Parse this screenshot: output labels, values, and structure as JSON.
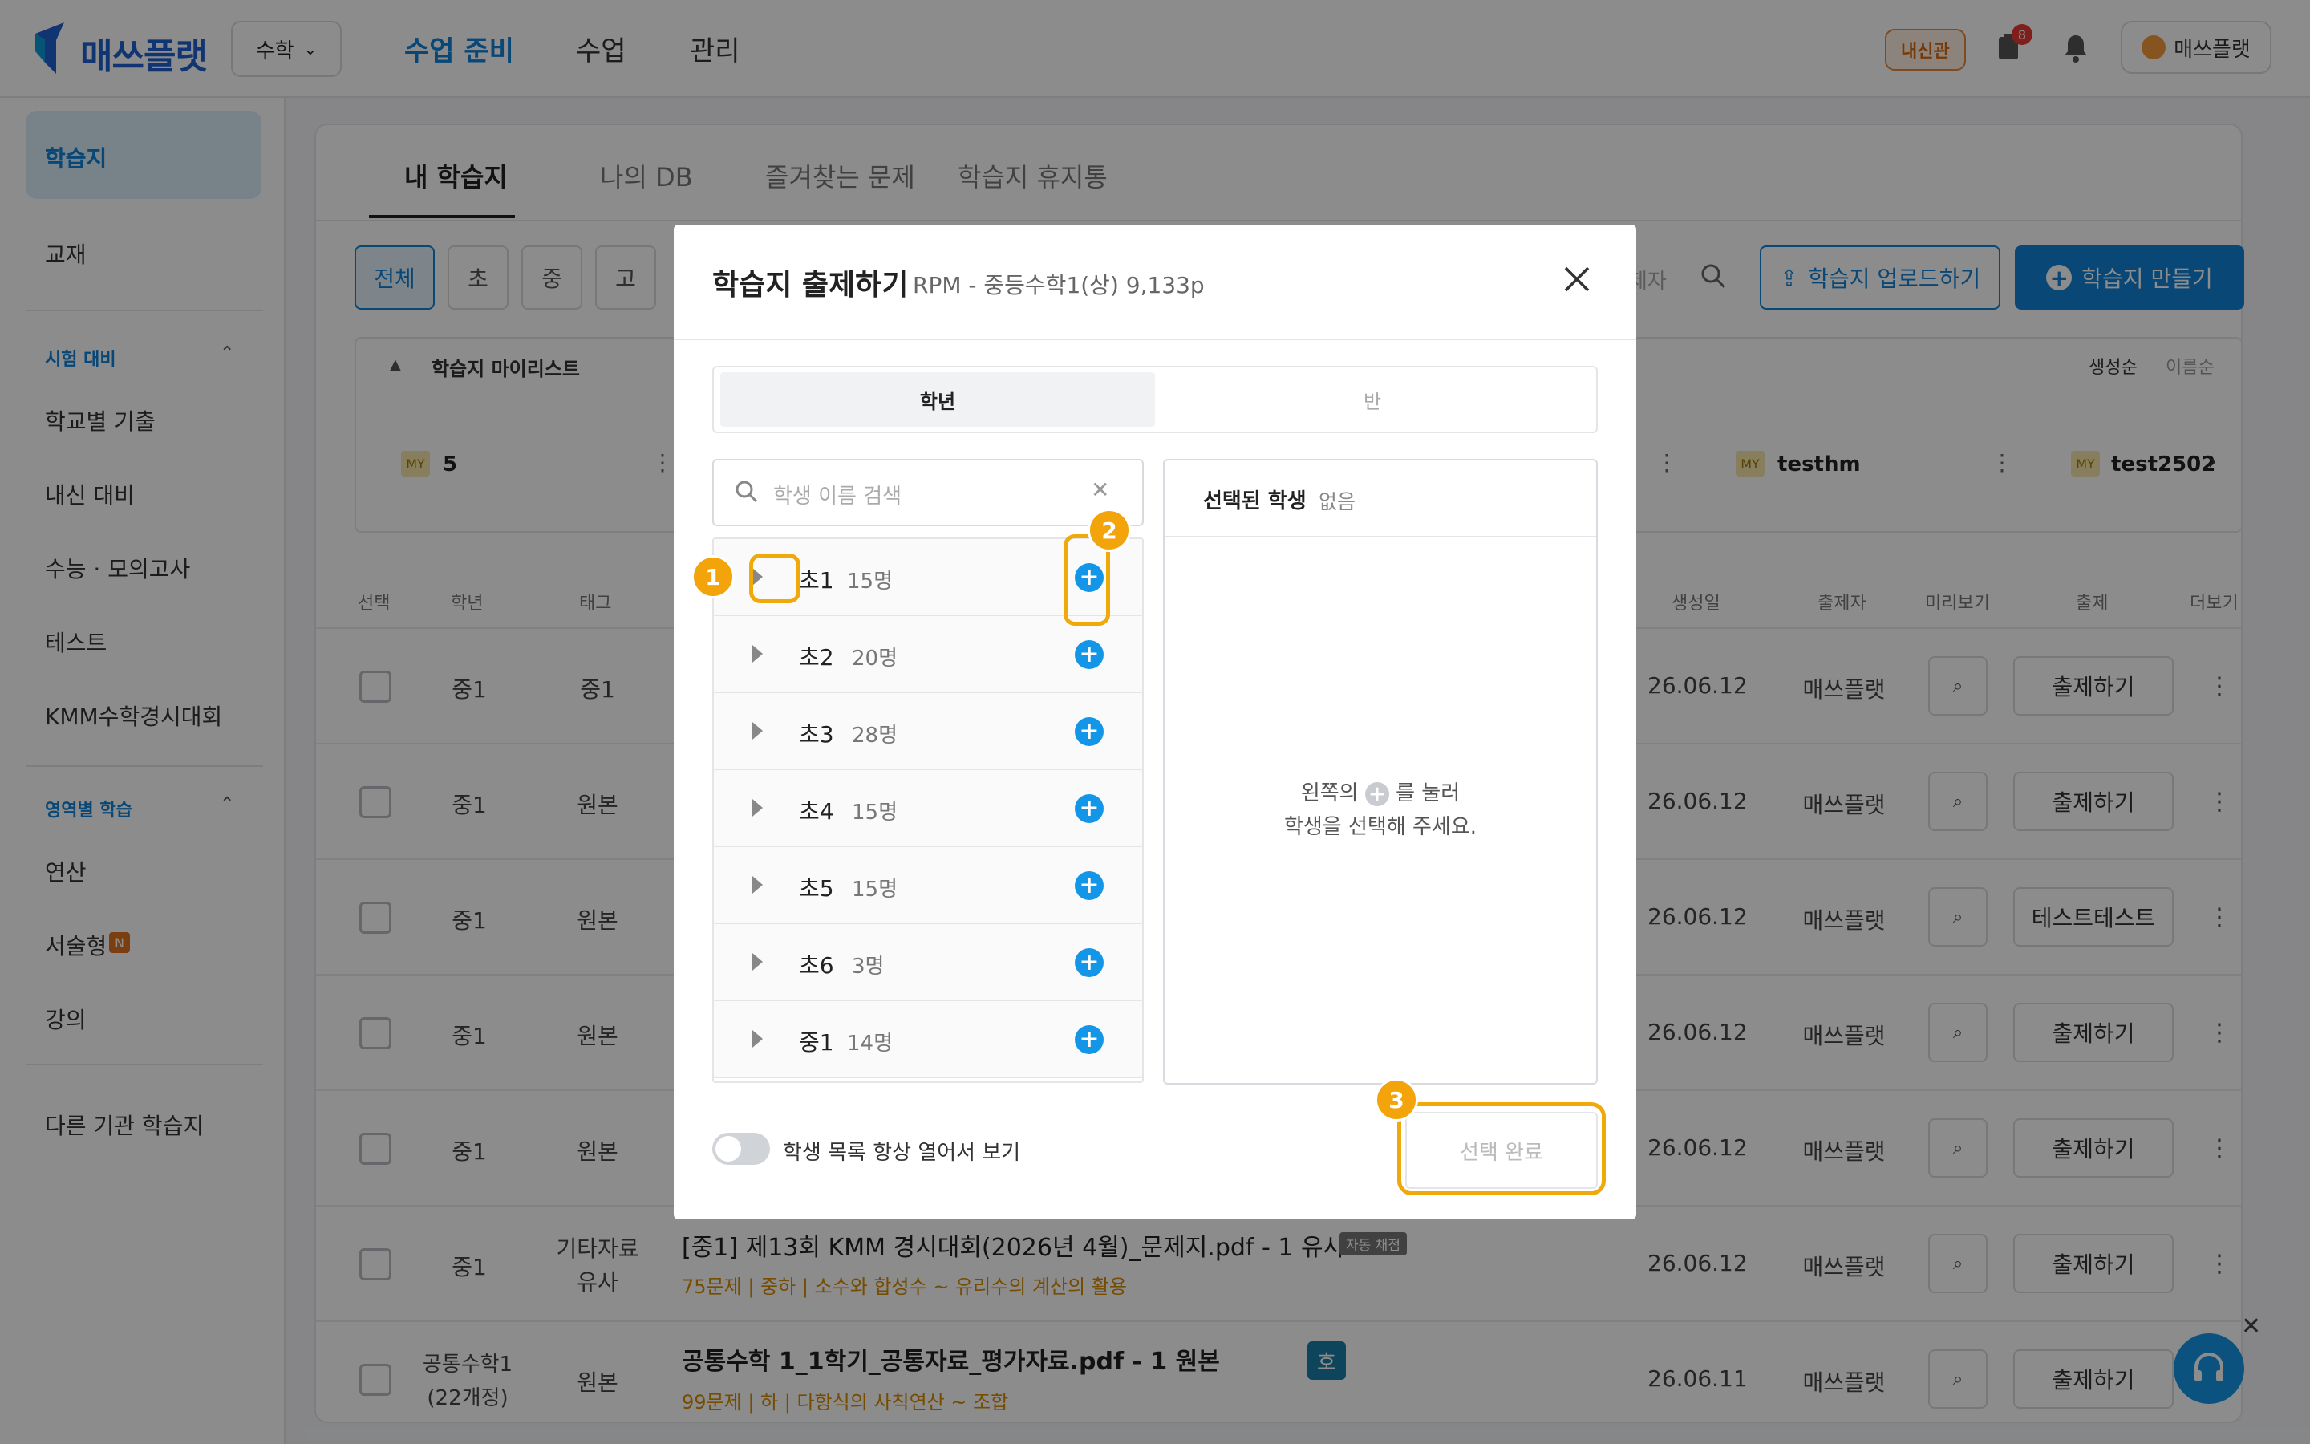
{
  "header": {
    "brand": "매쓰플랫",
    "subject": "수학",
    "nav": [
      "수업 준비",
      "수업",
      "관리"
    ],
    "school_badge": "내신관",
    "notification_count": "8",
    "user": "매쓰플랫"
  },
  "sidebar": {
    "items_top": [
      "학습지",
      "교재"
    ],
    "section_exam": "시험 대비",
    "exam_items": [
      "학교별 기출",
      "내신 대비",
      "수능 · 모의고사",
      "테스트",
      "KMM수학경시대회"
    ],
    "section_area": "영역별 학습",
    "area_items": [
      "연산",
      "서술형",
      "강의"
    ],
    "new_badge": "N",
    "other": "다른 기관 학습지"
  },
  "main": {
    "tabs": [
      "내 학습지",
      "나의 DB",
      "즐겨찾는 문제",
      "학습지 휴지통"
    ],
    "filters": [
      "전체",
      "초",
      "중",
      "고"
    ],
    "search_placeholder_partial": "제자",
    "upload_label": "학습지 업로드하기",
    "create_label": "학습지 만들기",
    "mylist_title": "학습지 마이리스트",
    "sort_options": [
      "생성순",
      "이름순"
    ],
    "mylist_cards": [
      "5",
      "testhm",
      "test2502"
    ],
    "my_tag": "MY",
    "columns": [
      "선택",
      "학년",
      "태그",
      "생성일",
      "출제자",
      "미리보기",
      "출제",
      "더보기"
    ],
    "rows": [
      {
        "grade": "중1",
        "tag": "중1",
        "date": "26.06.12",
        "author": "매쓰플랫",
        "action": "출제하기"
      },
      {
        "grade": "중1",
        "tag": "원본",
        "date": "26.06.12",
        "author": "매쓰플랫",
        "action": "출제하기"
      },
      {
        "grade": "중1",
        "tag": "원본",
        "date": "26.06.12",
        "author": "매쓰플랫",
        "action": "테스트테스트"
      },
      {
        "grade": "중1",
        "tag": "원본",
        "date": "26.06.12",
        "author": "매쓰플랫",
        "action": "출제하기"
      },
      {
        "grade": "중1",
        "tag": "원본",
        "date": "26.06.12",
        "author": "매쓰플랫",
        "action": "출제하기"
      },
      {
        "grade": "중1",
        "tag": "기타자료 유사",
        "title": "[중1] 제13회 KMM 경시대회(2026년 4월)_문제지.pdf - 1 유사",
        "badge": "자동 채점",
        "meta": "75문제 | 중하 | 소수와 합성수 ~ 유리수의 계산의 활용",
        "date": "26.06.12",
        "author": "매쓰플랫",
        "action": "출제하기"
      },
      {
        "grade": "공통수학1 (22개정)",
        "tag": "원본",
        "title": "공통수학 1_1학기_공통자료_평가자료.pdf - 1 원본",
        "badge": "호",
        "meta": "99문제 | 하 | 다항식의 사칙연산 ~ 조합",
        "date": "26.06.11",
        "author": "매쓰플랫",
        "action": "출제하기"
      }
    ]
  },
  "modal": {
    "title": "학습지 출제하기",
    "subtitle": "RPM - 중등수학1(상) 9,133p",
    "segments": [
      "학년",
      "반"
    ],
    "search_placeholder": "학생 이름 검색",
    "groups": [
      {
        "name": "초1",
        "count": "15명"
      },
      {
        "name": "초2",
        "count": "20명"
      },
      {
        "name": "초3",
        "count": "28명"
      },
      {
        "name": "초4",
        "count": "15명"
      },
      {
        "name": "초5",
        "count": "15명"
      },
      {
        "name": "초6",
        "count": "3명"
      },
      {
        "name": "중1",
        "count": "14명"
      }
    ],
    "selected_label": "선택된 학생",
    "selected_value": "없음",
    "empty_line1_before": "왼쪽의",
    "empty_line1_after": "를 눌러",
    "empty_line2": "학생을 선택해 주세요.",
    "toggle_label": "학생 목록 항상 열어서 보기",
    "done_label": "선택 완료"
  },
  "annotations": [
    "1",
    "2",
    "3"
  ],
  "colors": {
    "accent": "#1182d8",
    "highlight": "#f0a90a"
  }
}
